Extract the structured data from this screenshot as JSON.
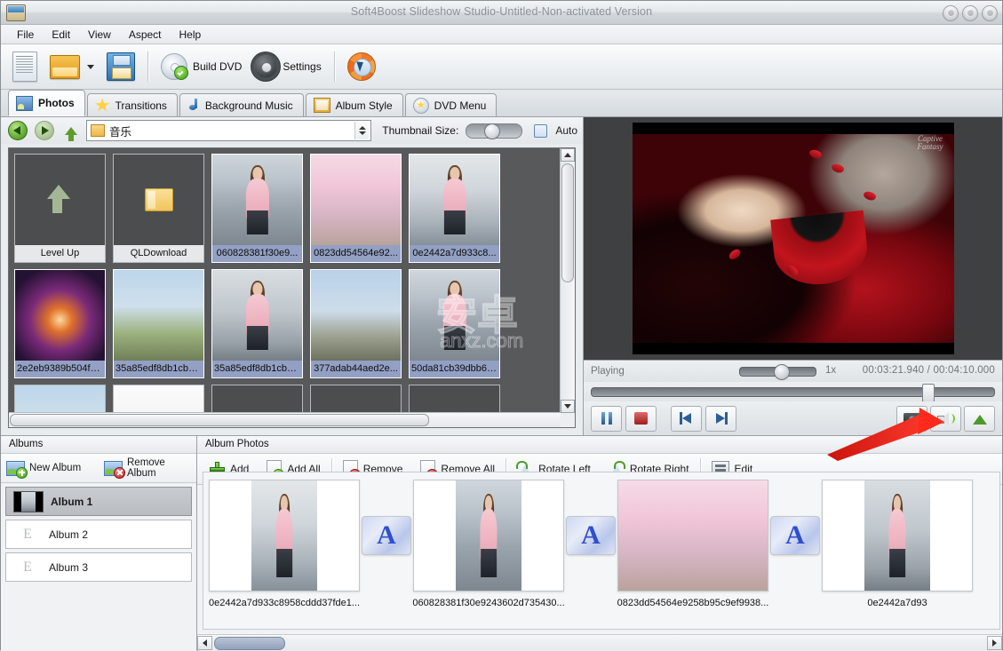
{
  "window": {
    "title": "Soft4Boost Slideshow Studio-Untitled-Non-activated Version",
    "icon": "app-icon"
  },
  "menu": {
    "items": [
      {
        "label": "File",
        "accel": "F"
      },
      {
        "label": "Edit",
        "accel": "E"
      },
      {
        "label": "View",
        "accel": "V"
      },
      {
        "label": "Aspect",
        "accel": "A"
      },
      {
        "label": "Help",
        "accel": "H"
      }
    ]
  },
  "toolbar": {
    "new_label": "",
    "open_label": "",
    "save_label": "",
    "build_dvd_label": "Build DVD",
    "settings_label": "Settings",
    "help_label": ""
  },
  "tabs": [
    {
      "label": "Photos",
      "icon": "photos-icon",
      "active": true
    },
    {
      "label": "Transitions",
      "icon": "star-icon",
      "active": false
    },
    {
      "label": "Background Music",
      "icon": "music-note-icon",
      "active": false
    },
    {
      "label": "Album Style",
      "icon": "album-icon",
      "active": false
    },
    {
      "label": "DVD Menu",
      "icon": "dvd-menu-icon",
      "active": false
    }
  ],
  "browser": {
    "back_icon": "back-arrow-icon",
    "forward_icon": "forward-arrow-icon",
    "up_icon": "level-up-icon",
    "path": "音乐",
    "thumbnail_size_label": "Thumbnail Size:",
    "thumbnail_size_value": 35,
    "auto_label": "Auto",
    "auto_checked": false,
    "files": [
      {
        "name": "Level Up",
        "type": "parent-folder"
      },
      {
        "name": "QLDownload",
        "type": "folder"
      },
      {
        "name": "060828381f30e9...",
        "type": "image",
        "selected": true,
        "style": "p-girl1"
      },
      {
        "name": "0823dd54564e92...",
        "type": "image",
        "selected": true,
        "style": "p-blossom"
      },
      {
        "name": "0e2442a7d933c8...",
        "type": "image",
        "selected": true,
        "style": "p-girl2"
      },
      {
        "name": "2e2eb9389b504fc...",
        "type": "image",
        "selected": true,
        "style": "p-fire"
      },
      {
        "name": "35a85edf8db1cb1...",
        "type": "image",
        "selected": true,
        "style": "p-temple"
      },
      {
        "name": "35a85edf8db1cb1...",
        "type": "image",
        "selected": true,
        "style": "p-girl3"
      },
      {
        "name": "377adab44aed2e...",
        "type": "image",
        "selected": true,
        "style": "p-pagoda"
      },
      {
        "name": "50da81cb39dbb6f...",
        "type": "image",
        "selected": true,
        "style": "p-girl1"
      }
    ]
  },
  "player": {
    "status": "Playing",
    "speed": "1x",
    "time": "00:03:21.940 / 00:04:10.000",
    "current_time": "00:03:21.940",
    "total_time": "00:04:10.000",
    "seek_percent": 81,
    "signature": "Captive\nFantasy",
    "controls": [
      {
        "name": "pause-button",
        "icon": "pause-icon"
      },
      {
        "name": "stop-button",
        "icon": "stop-icon"
      },
      {
        "name": "previous-button",
        "icon": "previous-icon"
      },
      {
        "name": "next-button",
        "icon": "next-icon"
      }
    ],
    "right_controls": [
      {
        "name": "snapshot-button",
        "icon": "camera-icon"
      },
      {
        "name": "volume-button",
        "icon": "volume-icon"
      },
      {
        "name": "eject-button",
        "icon": "eject-icon"
      }
    ]
  },
  "albums": {
    "header": "Albums",
    "new_album_label": "New Album",
    "remove_album_label": "Remove\nAlbum",
    "new_album_line1": "New Album",
    "remove_album_line1": "Remove",
    "remove_album_line2": "Album",
    "items": [
      {
        "label": "Album 1",
        "selected": true,
        "has_thumb": true
      },
      {
        "label": "Album 2",
        "selected": false,
        "has_thumb": false,
        "empty_mark": "E"
      },
      {
        "label": "Album 3",
        "selected": false,
        "has_thumb": false,
        "empty_mark": "E"
      }
    ]
  },
  "album_photos": {
    "header": "Album Photos",
    "buttons": [
      {
        "label": "Add",
        "icon": "plus-icon"
      },
      {
        "label": "Add All",
        "icon": "add-all-icon"
      },
      {
        "label": "Remove",
        "icon": "remove-icon"
      },
      {
        "label": "Remove All",
        "icon": "remove-all-icon"
      },
      {
        "label": "Rotate Left",
        "icon": "rotate-left-icon"
      },
      {
        "label": "Rotate Right",
        "icon": "rotate-right-icon"
      },
      {
        "label": "Edit",
        "icon": "edit-icon"
      }
    ],
    "slides": [
      {
        "name": "0e2442a7d933c8958cddd37fde1...",
        "style": "p-girl2"
      },
      {
        "name": "060828381f30e9243602d735430...",
        "style": "p-girl1"
      },
      {
        "name": "0823dd54564e9258b95c9ef9938...",
        "style": "p-blossom"
      },
      {
        "name": "0e2442a7d93",
        "style": "p-girl3"
      }
    ],
    "transition_label": "A"
  },
  "colors": {
    "accent": "#2f4fcf",
    "selection": "#93a0c4",
    "titlebar_text": "#8d9298",
    "grid_bg": "#58595b",
    "arrow_annotation": "#e32119"
  },
  "annotation": {
    "arrow_color": "#e32119",
    "points_to": "volume-button"
  }
}
